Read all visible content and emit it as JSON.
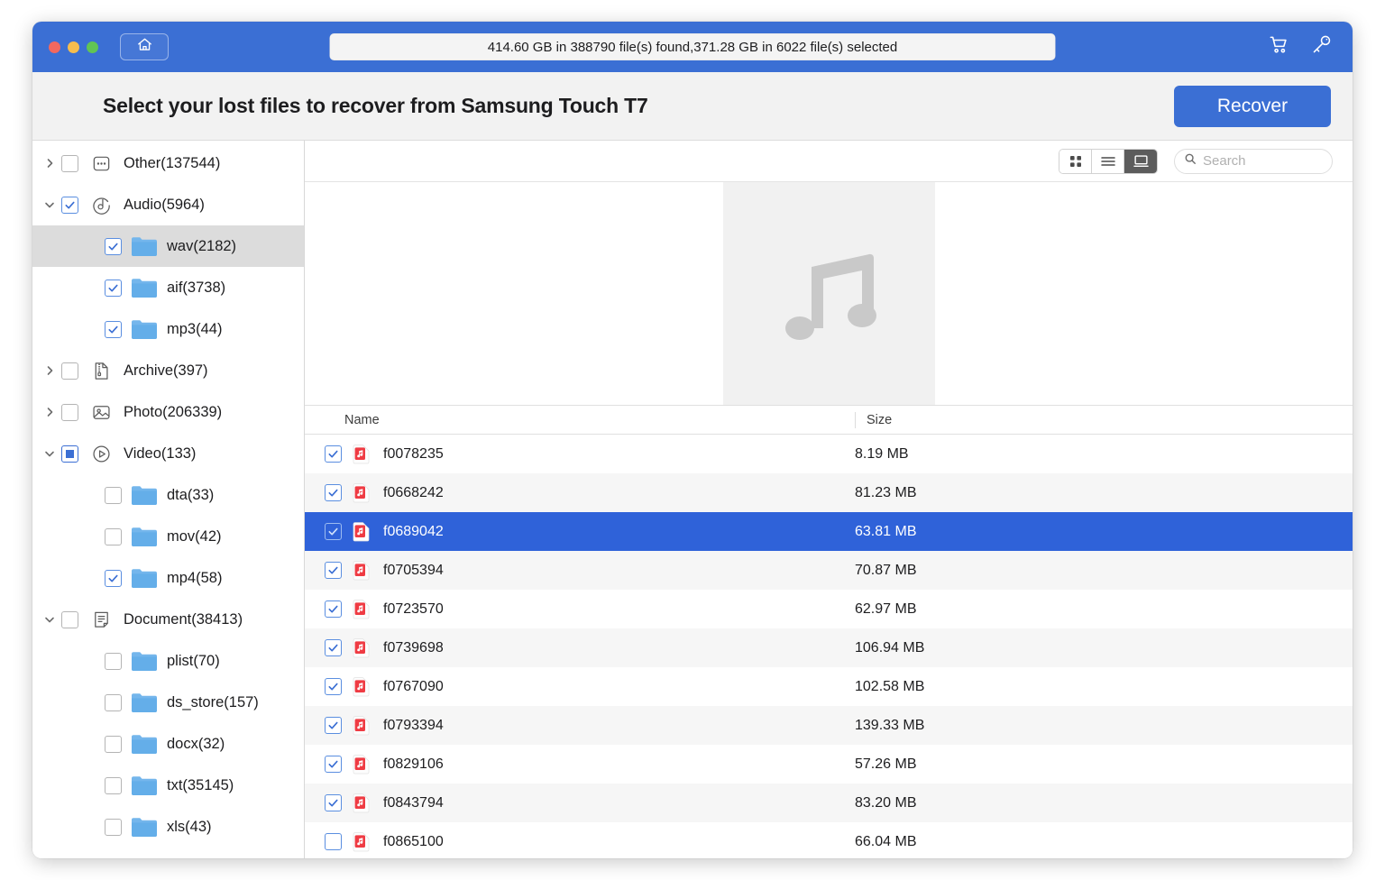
{
  "window": {
    "titlebar": {
      "status_text": "414.60 GB in 388790 file(s) found,371.28 GB in 6022 file(s) selected",
      "home_icon": "home-icon",
      "cart_icon": "cart-icon",
      "key_icon": "key-icon",
      "accent_color": "#3b6fd4"
    },
    "header": {
      "title": "Select your lost files to recover from Samsung Touch T7",
      "recover_label": "Recover"
    }
  },
  "sidebar": {
    "items": [
      {
        "label": "Other(137544)",
        "level": 0,
        "state": "off",
        "expanded": false,
        "icon": "ellipsis-icon",
        "selected": false
      },
      {
        "label": "Audio(5964)",
        "level": 0,
        "state": "on",
        "expanded": true,
        "icon": "audio-icon",
        "selected": false
      },
      {
        "label": "wav(2182)",
        "level": 1,
        "state": "on",
        "expanded": null,
        "icon": "folder-icon",
        "selected": true
      },
      {
        "label": "aif(3738)",
        "level": 1,
        "state": "on",
        "expanded": null,
        "icon": "folder-icon",
        "selected": false
      },
      {
        "label": "mp3(44)",
        "level": 1,
        "state": "on",
        "expanded": null,
        "icon": "folder-icon",
        "selected": false
      },
      {
        "label": "Archive(397)",
        "level": 0,
        "state": "off",
        "expanded": false,
        "icon": "archive-icon",
        "selected": false
      },
      {
        "label": "Photo(206339)",
        "level": 0,
        "state": "off",
        "expanded": false,
        "icon": "photo-icon",
        "selected": false
      },
      {
        "label": "Video(133)",
        "level": 0,
        "state": "mixed",
        "expanded": true,
        "icon": "video-icon",
        "selected": false
      },
      {
        "label": "dta(33)",
        "level": 1,
        "state": "off",
        "expanded": null,
        "icon": "folder-icon",
        "selected": false
      },
      {
        "label": "mov(42)",
        "level": 1,
        "state": "off",
        "expanded": null,
        "icon": "folder-icon",
        "selected": false
      },
      {
        "label": "mp4(58)",
        "level": 1,
        "state": "on",
        "expanded": null,
        "icon": "folder-icon",
        "selected": false
      },
      {
        "label": "Document(38413)",
        "level": 0,
        "state": "off",
        "expanded": true,
        "icon": "document-icon",
        "selected": false
      },
      {
        "label": "plist(70)",
        "level": 1,
        "state": "off",
        "expanded": null,
        "icon": "folder-icon",
        "selected": false
      },
      {
        "label": "ds_store(157)",
        "level": 1,
        "state": "off",
        "expanded": null,
        "icon": "folder-icon",
        "selected": false
      },
      {
        "label": "docx(32)",
        "level": 1,
        "state": "off",
        "expanded": null,
        "icon": "folder-icon",
        "selected": false
      },
      {
        "label": "txt(35145)",
        "level": 1,
        "state": "off",
        "expanded": null,
        "icon": "folder-icon",
        "selected": false
      },
      {
        "label": "xls(43)",
        "level": 1,
        "state": "off",
        "expanded": null,
        "icon": "folder-icon",
        "selected": false
      }
    ]
  },
  "toolbar": {
    "views": [
      {
        "name": "grid-view-button",
        "icon": "grid-icon",
        "active": false
      },
      {
        "name": "list-view-button",
        "icon": "list-icon",
        "active": false
      },
      {
        "name": "preview-view-button",
        "icon": "preview-icon",
        "active": true
      }
    ],
    "search_placeholder": "Search",
    "search_value": "",
    "search_icon": "search-icon"
  },
  "preview": {
    "icon": "music-note-icon"
  },
  "file_table": {
    "columns": [
      "Name",
      "Size"
    ],
    "rows": [
      {
        "name": "f0078235",
        "size": "8.19 MB",
        "checked": true,
        "selected": false
      },
      {
        "name": "f0668242",
        "size": "81.23 MB",
        "checked": true,
        "selected": false
      },
      {
        "name": "f0689042",
        "size": "63.81 MB",
        "checked": true,
        "selected": true
      },
      {
        "name": "f0705394",
        "size": "70.87 MB",
        "checked": true,
        "selected": false
      },
      {
        "name": "f0723570",
        "size": "62.97 MB",
        "checked": true,
        "selected": false
      },
      {
        "name": "f0739698",
        "size": "106.94 MB",
        "checked": true,
        "selected": false
      },
      {
        "name": "f0767090",
        "size": "102.58 MB",
        "checked": true,
        "selected": false
      },
      {
        "name": "f0793394",
        "size": "139.33 MB",
        "checked": true,
        "selected": false
      },
      {
        "name": "f0829106",
        "size": "57.26 MB",
        "checked": true,
        "selected": false
      },
      {
        "name": "f0843794",
        "size": "83.20 MB",
        "checked": true,
        "selected": false
      },
      {
        "name": "f0865100",
        "size": "66.04 MB",
        "checked": false,
        "selected": false
      }
    ]
  }
}
